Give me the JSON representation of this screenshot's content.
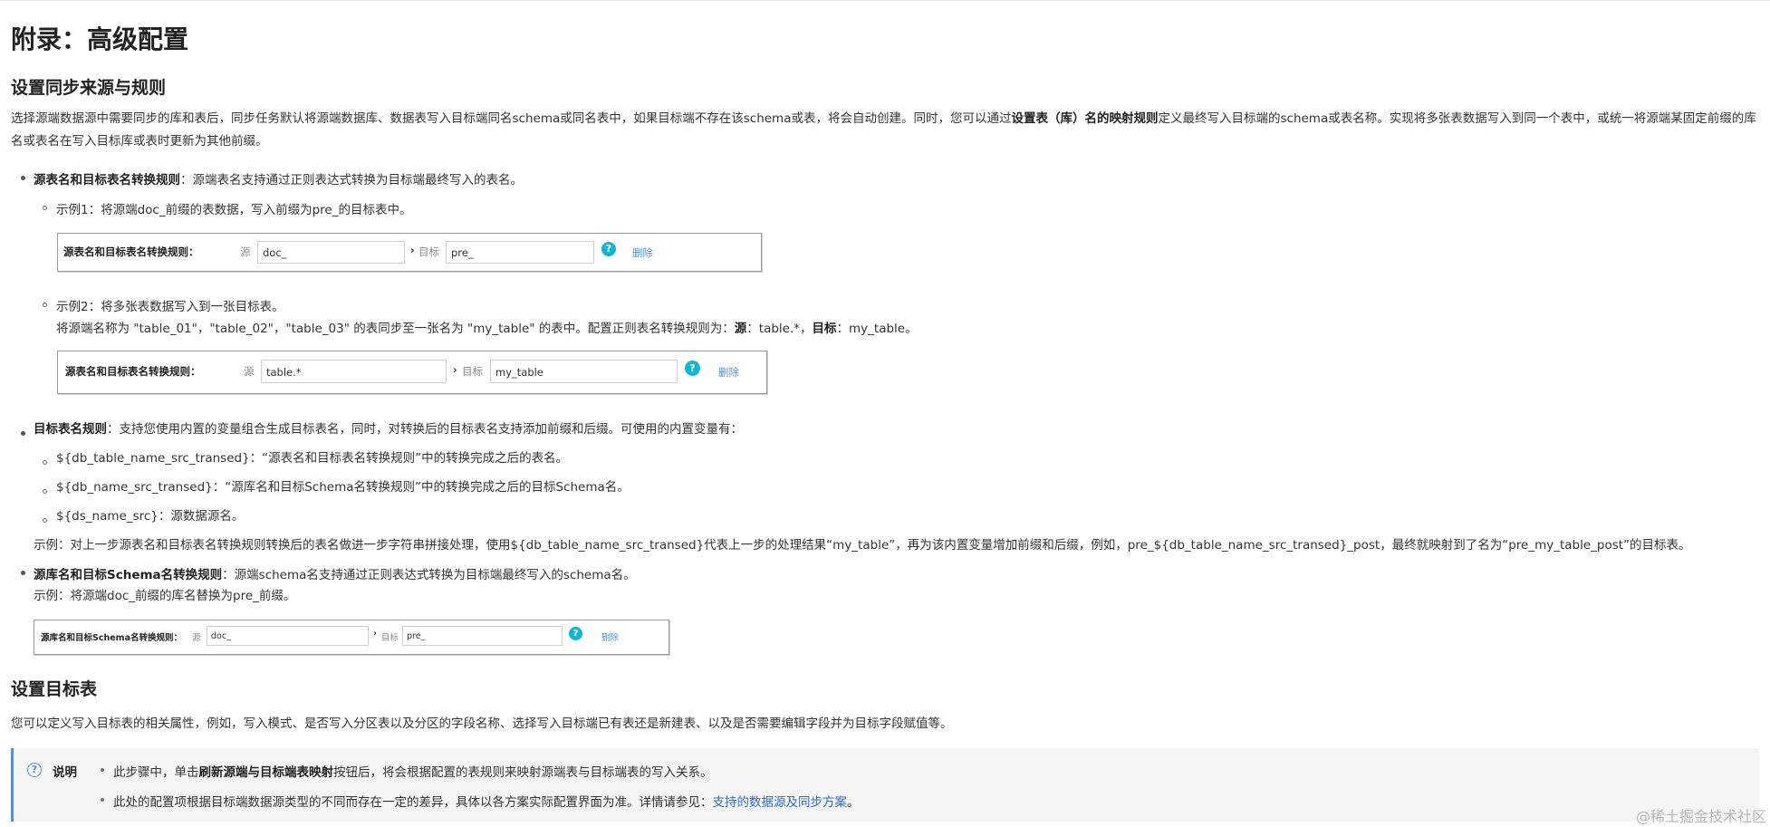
{
  "title": "附录：高级配置",
  "section1": {
    "heading": "设置同步来源与规则",
    "intro_a": "选择源端数据源中需要同步的库和表后，同步任务默认将源端数据库、数据表写入目标端同名schema或同名表中，如果目标端不存在该schema或表，将会自动创建。同时，您可以通过",
    "intro_b": "设置表（库）名的映射规则",
    "intro_c": "定义最终写入目标端的schema或表名称。实现将多张表数据写入到同一个表中，或统一将源端某固定前缀的库名或表名在写入目标库或表时更新为其他前缀。"
  },
  "rule1": {
    "name": "源表名和目标表名转换规则",
    "desc": "：源端表名支持通过正则表达式转换为目标端最终写入的表名。",
    "ex1": "示例1：将源端doc_前缀的表数据，写入前缀为pre_的目标表中。",
    "ex2": "示例2：将多张表数据写入到一张目标表。",
    "ex2_line_a": "将源端名称为 \"table_01\"，\"table_02\"，\"table_03\" 的表同步至一张名为 \"my_table\" 的表中。配置正则表名转换规则为：",
    "ex2_src_label": "源",
    "ex2_src_val": "：table.*，",
    "ex2_tgt_label": "目标",
    "ex2_tgt_val": "：my_table。"
  },
  "config1": {
    "label": "源表名和目标表名转换规则：",
    "src_label": "源",
    "src_value": "doc_",
    "tgt_label": "目标",
    "tgt_value": "pre_",
    "help": "?",
    "delete": "删除"
  },
  "config2": {
    "label": "源表名和目标表名转换规则：",
    "src_label": "源",
    "src_value": "table.*",
    "tgt_label": "目标",
    "tgt_value": "my_table",
    "help": "?",
    "delete": "删除"
  },
  "rule2": {
    "name": "目标表名规则",
    "desc": "：支持您使用内置的变量组合生成目标表名，同时，对转换后的目标表名支持添加前缀和后缀。可使用的内置变量有：",
    "vars": [
      "${db_table_name_src_transed}：“源表名和目标表名转换规则”中的转换完成之后的表名。",
      "${db_name_src_transed}：“源库名和目标Schema名转换规则”中的转换完成之后的目标Schema名。",
      "${ds_name_src}：源数据源名。"
    ],
    "example": "示例：对上一步源表名和目标表名转换规则转换后的表名做进一步字符串拼接处理，使用${db_table_name_src_transed}代表上一步的处理结果“my_table”，再为该内置变量增加前缀和后缀，例如，pre_${db_table_name_src_transed}_post，最终就映射到了名为“pre_my_table_post”的目标表。"
  },
  "rule3": {
    "name": "源库名和目标Schema名转换规则",
    "desc": "：源端schema名支持通过正则表达式转换为目标端最终写入的schema名。",
    "example": "示例：将源端doc_前缀的库名替换为pre_前缀。"
  },
  "config3": {
    "label": "源库名和目标Schema名转换规则：",
    "src_label": "源",
    "src_value": "doc_",
    "tgt_label": "目标",
    "tgt_value": "pre_",
    "help": "?",
    "delete": "删除"
  },
  "section2": {
    "heading": "设置目标表",
    "text": "您可以定义写入目标表的相关属性，例如，写入模式、是否写入分区表以及分区的字段名称、选择写入目标端已有表还是新建表、以及是否需要编辑字段并为目标字段赋值等。"
  },
  "note": {
    "icon": "?",
    "title": "说明",
    "item1_a": "此步骤中，单击",
    "item1_b": "刷新源端与目标端表映射",
    "item1_c": "按钮后，将会根据配置的表规则来映射源端表与目标端表的写入关系。",
    "item2_a": "此处的配置项根据目标端数据源类型的不同而存在一定的差异，具体以各方案实际配置界面为准。详情请参见：",
    "item2_link": "支持的数据源及同步方案",
    "item2_c": "。"
  },
  "watermark": "@稀土掘金技术社区"
}
